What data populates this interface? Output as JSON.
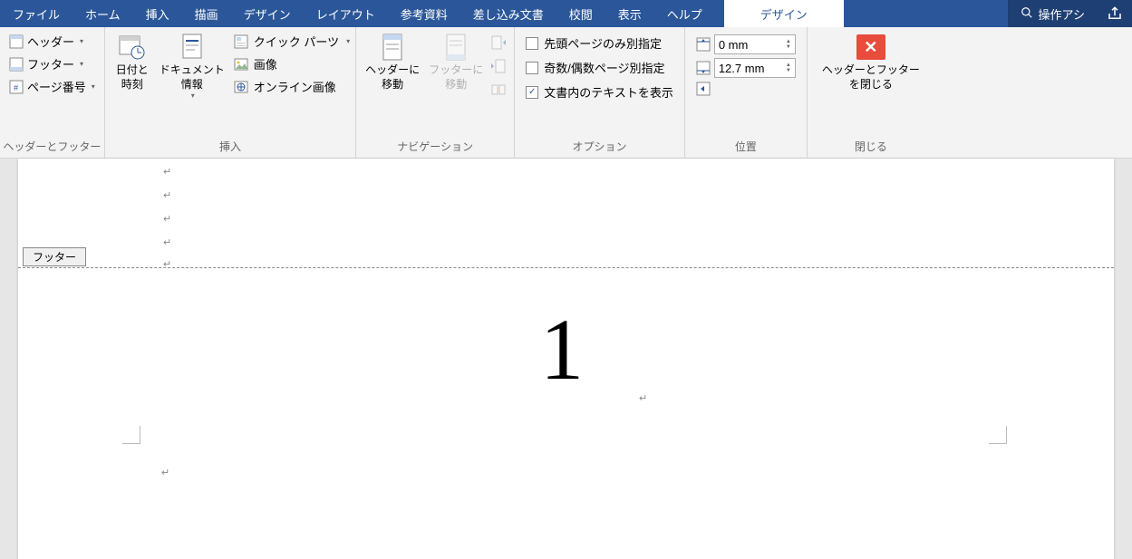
{
  "menubar": {
    "file": "ファイル",
    "items": [
      "ホーム",
      "挿入",
      "描画",
      "デザイン",
      "レイアウト",
      "参考資料",
      "差し込み文書",
      "校閲",
      "表示",
      "ヘルプ"
    ],
    "contextual": "デザイン",
    "search": "操作アシ"
  },
  "ribbon": {
    "group1": {
      "label": "ヘッダーとフッター",
      "header": "ヘッダー",
      "footer": "フッター",
      "pageNumber": "ページ番号"
    },
    "group2": {
      "label": "挿入",
      "datetime": "日付と\n時刻",
      "docinfo": "ドキュメント\n情報",
      "quickparts": "クイック パーツ",
      "image": "画像",
      "onlineImage": "オンライン画像"
    },
    "group3": {
      "label": "ナビゲーション",
      "gotoHeader": "ヘッダーに\n移動",
      "gotoFooter": "フッターに\n移動"
    },
    "group4": {
      "label": "オプション",
      "firstPage": "先頭ページのみ別指定",
      "oddEven": "奇数/偶数ページ別指定",
      "showText": "文書内のテキストを表示"
    },
    "group5": {
      "label": "位置",
      "top": "0 mm",
      "bottom": "12.7 mm"
    },
    "group6": {
      "label": "閉じる",
      "button": "ヘッダーとフッター\nを閉じる"
    }
  },
  "document": {
    "footerTag": "フッター",
    "pageNumber": "1"
  }
}
